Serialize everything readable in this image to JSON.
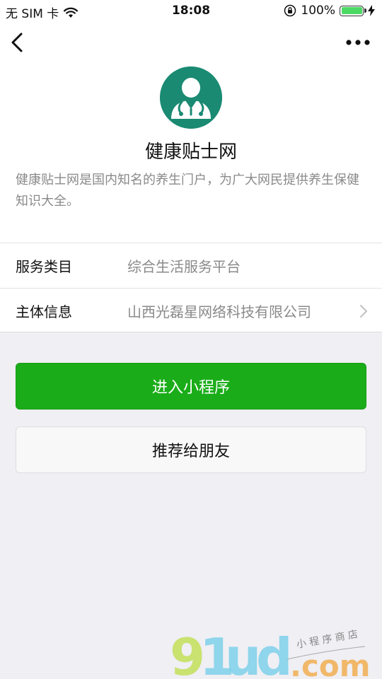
{
  "status_bar": {
    "carrier": "无 SIM 卡",
    "time": "18:08",
    "battery_percent": "100%",
    "battery_level": 1.0
  },
  "nav": {
    "back_icon": "chevron-left-icon",
    "more_icon": "more-dots-icon"
  },
  "profile": {
    "avatar_icon": "doctor-icon",
    "avatar_color": "#1a8a73",
    "name": "健康贴士网",
    "description": "健康贴士网是国内知名的养生门户，为广大网民提供养生保健知识大全。"
  },
  "info": {
    "rows": [
      {
        "label": "服务类目",
        "value": "综合生活服务平台"
      },
      {
        "label": "主体信息",
        "value": "山西光磊星网络科技有限公司"
      }
    ]
  },
  "actions": {
    "primary_label": "进入小程序",
    "secondary_label": "推荐给朋友",
    "primary_color": "#1aad19"
  },
  "watermark": {
    "brand": "91ud",
    "domain": ".com",
    "tagline": "小程序商店"
  }
}
